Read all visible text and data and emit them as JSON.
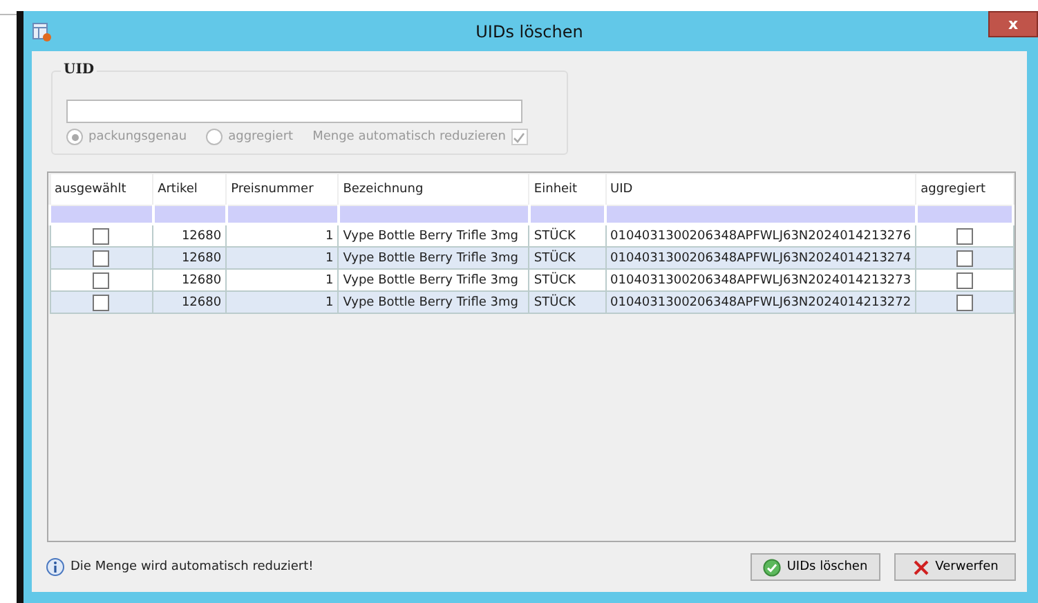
{
  "window": {
    "title": "UIDs löschen",
    "close": "x"
  },
  "uid_group": {
    "title": "UID",
    "options": [
      {
        "label": "packungsgenau",
        "selected": true,
        "disabled": true
      },
      {
        "label": "aggregiert",
        "selected": false,
        "disabled": true
      }
    ],
    "auto_reduce": {
      "label": "Menge automatisch reduzieren",
      "checked": true,
      "disabled": true
    }
  },
  "table": {
    "columns": [
      "ausgewählt",
      "Artikel",
      "Preisnummer",
      "Bezeichnung",
      "Einheit",
      "UID",
      "aggregiert"
    ],
    "rows": [
      {
        "selected": false,
        "artikel": "12680",
        "preisnummer": "1",
        "bezeichnung": "Vype Bottle Berry Trifle 3mg",
        "einheit": "STÜCK",
        "uid": "0104031300206348APFWLJ63N2024014213276",
        "aggregiert": false
      },
      {
        "selected": false,
        "artikel": "12680",
        "preisnummer": "1",
        "bezeichnung": "Vype Bottle Berry Trifle 3mg",
        "einheit": "STÜCK",
        "uid": "0104031300206348APFWLJ63N2024014213274",
        "aggregiert": false
      },
      {
        "selected": false,
        "artikel": "12680",
        "preisnummer": "1",
        "bezeichnung": "Vype Bottle Berry Trifle 3mg",
        "einheit": "STÜCK",
        "uid": "0104031300206348APFWLJ63N2024014213273",
        "aggregiert": false
      },
      {
        "selected": false,
        "artikel": "12680",
        "preisnummer": "1",
        "bezeichnung": "Vype Bottle Berry Trifle 3mg",
        "einheit": "STÜCK",
        "uid": "0104031300206348APFWLJ63N2024014213272",
        "aggregiert": false
      }
    ]
  },
  "status": {
    "message": "Die Menge wird automatisch reduziert!"
  },
  "buttons": [
    {
      "label": "UIDs löschen",
      "kind": "confirm"
    },
    {
      "label": "Verwerfen",
      "kind": "cancel"
    }
  ]
}
